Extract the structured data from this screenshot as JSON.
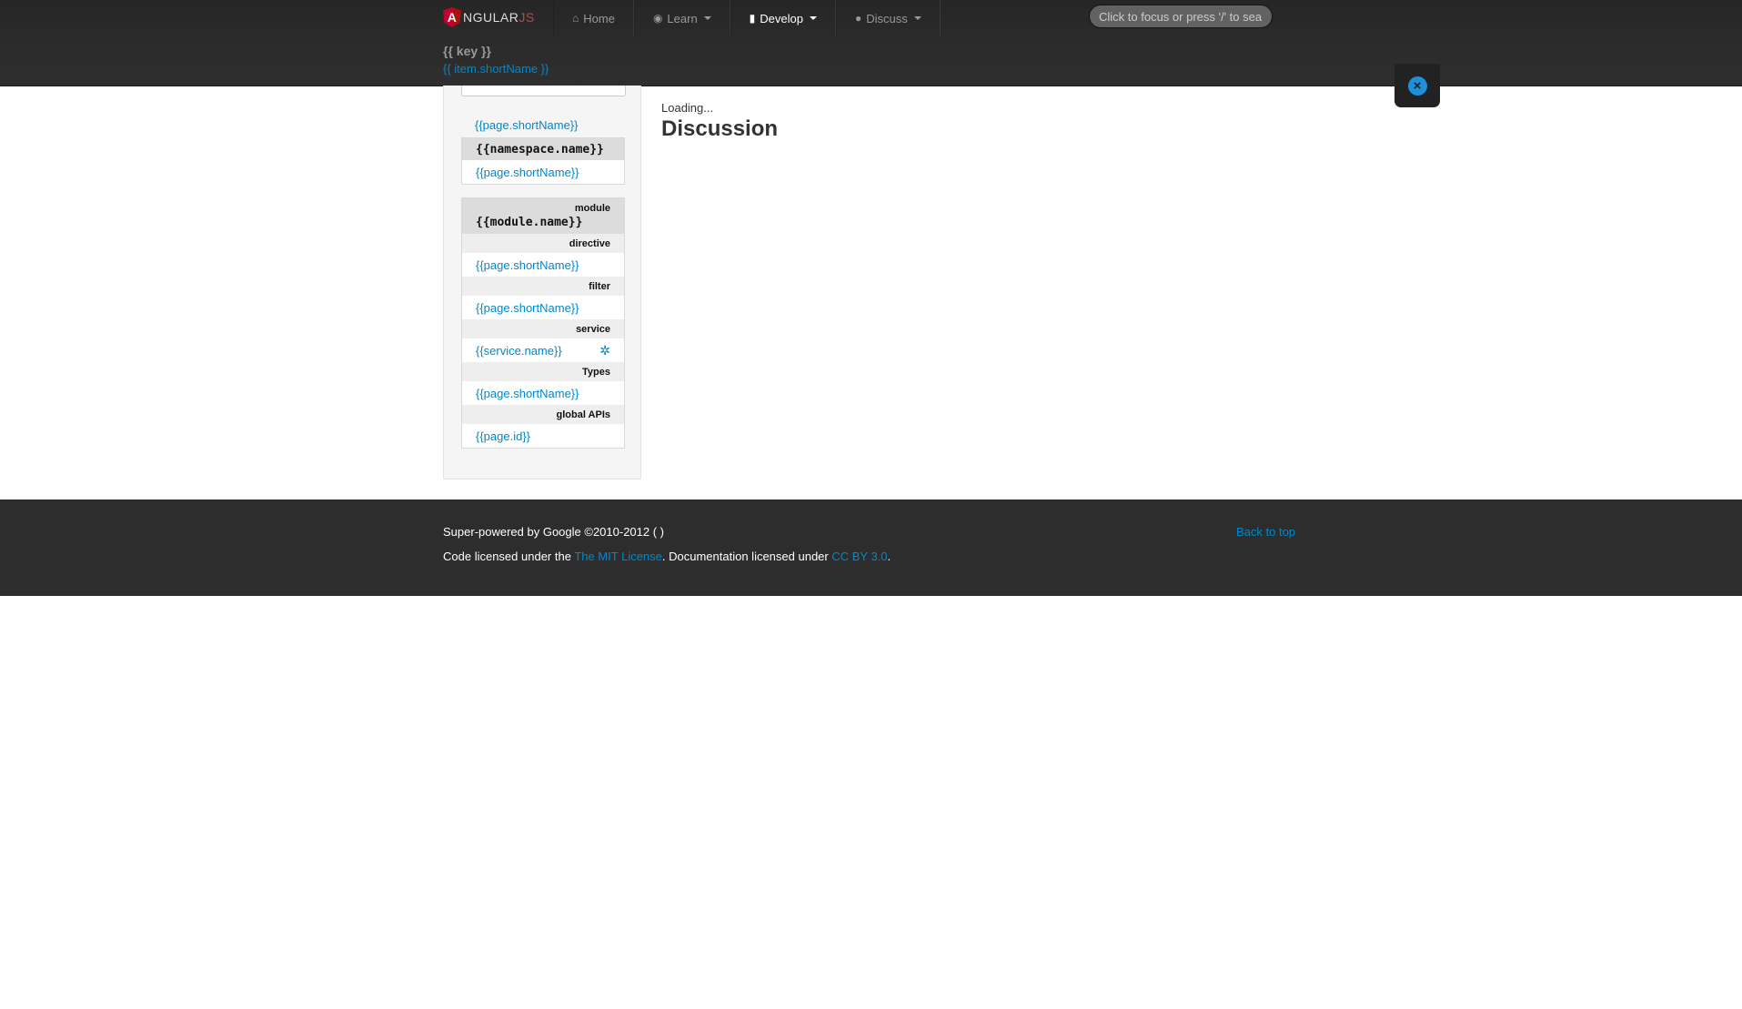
{
  "navbar": {
    "brand": {
      "main": "NGULAR",
      "suffix": "JS",
      "logo_letter": "A"
    },
    "items": [
      {
        "label": "Home",
        "icon": "home-icon",
        "has_caret": false,
        "active": false
      },
      {
        "label": "Learn",
        "icon": "eye-icon",
        "has_caret": true,
        "active": false
      },
      {
        "label": "Develop",
        "icon": "book-icon",
        "has_caret": true,
        "active": true
      },
      {
        "label": "Discuss",
        "icon": "comment-icon",
        "has_caret": true,
        "active": false
      }
    ],
    "search_placeholder": "Click to focus or press '/' to search"
  },
  "subheader": {
    "key": "{{ key }}",
    "item": "{{ item.shortName }}"
  },
  "close_button": {
    "icon": "close-icon",
    "glyph": "×"
  },
  "sidebar": {
    "top_link": "{{page.shortName}}",
    "namespace_group": {
      "header": "{{namespace.name}}",
      "link": "{{page.shortName}}"
    },
    "module_group": {
      "type": "module",
      "name": "{{module.name}}",
      "sections": [
        {
          "title": "directive",
          "link": "{{page.shortName}}",
          "icon": null
        },
        {
          "title": "filter",
          "link": "{{page.shortName}}",
          "icon": null
        },
        {
          "title": "service",
          "link": "{{service.name}}",
          "icon": "gear-icon"
        },
        {
          "title": "Types",
          "link": "{{page.shortName}}",
          "icon": null
        },
        {
          "title": "global APIs",
          "link": "{{page.id}}",
          "icon": null
        }
      ]
    }
  },
  "main": {
    "loading": "Loading...",
    "title": "Discussion"
  },
  "footer": {
    "line1": "Super-powered by Google ©2010-2012 ( )",
    "line2_prefix": "Code licensed under the ",
    "license_link": "The MIT License",
    "line2_middle": ". Documentation licensed under ",
    "docs_link": "CC BY 3.0",
    "line2_suffix": ".",
    "back_to_top": "Back to top"
  },
  "colors": {
    "navbar_bg": "#2a2a2a",
    "link": "#0088cc",
    "brand_accent": "#c4473a",
    "footer_bg": "#2d2d2d"
  }
}
